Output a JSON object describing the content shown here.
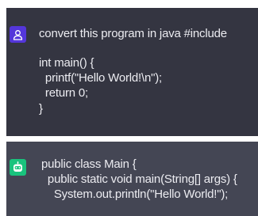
{
  "colors": {
    "user_message_bg": "#343541",
    "assistant_message_bg": "#444654",
    "user_avatar_bg": "#5436da",
    "assistant_avatar_bg": "#19c37d",
    "text": "#ececf1"
  },
  "icons": {
    "user_avatar": "person-icon",
    "assistant_avatar": "robot-icon"
  },
  "user_message": {
    "lines": [
      "convert this program in java #include",
      "int main() {",
      "  printf(\"Hello World!\\n\");",
      "  return 0;",
      "}"
    ]
  },
  "assistant_message": {
    "lines": [
      "public class Main {",
      "  public static void main(String[] args) {",
      "    System.out.println(\"Hello World!\");"
    ]
  }
}
